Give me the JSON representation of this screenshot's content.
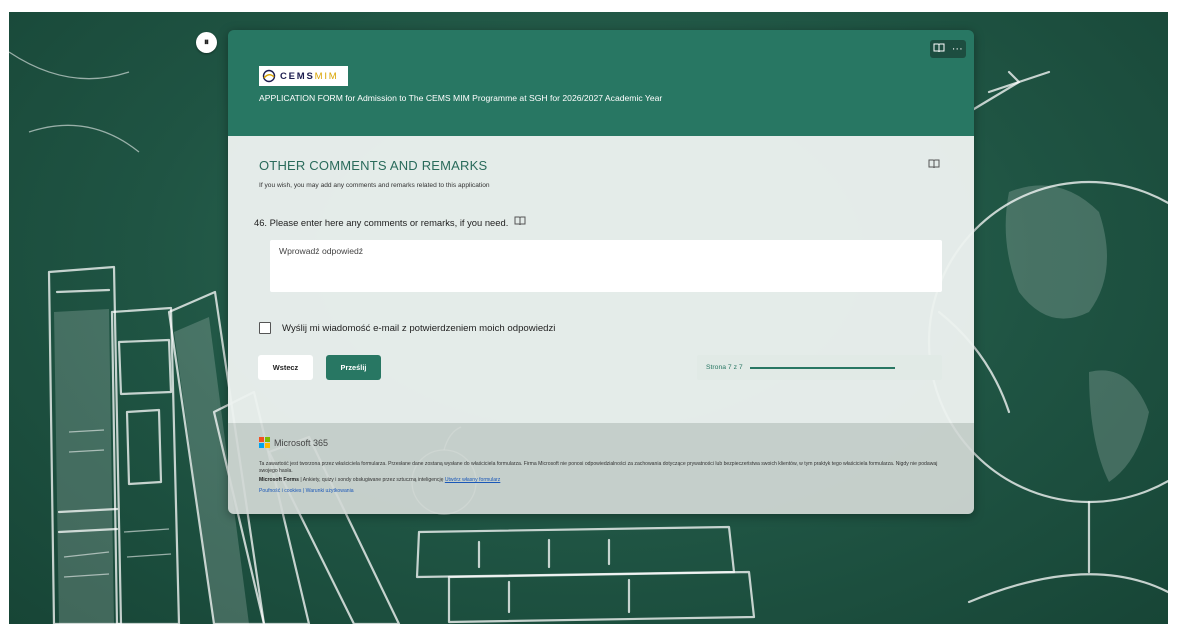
{
  "header": {
    "logo_text_main": "CEMS",
    "logo_text_accent": "MIM",
    "title": "APPLICATION FORM for Admission to The CEMS MIM Programme at SGH for 2026/2027 Academic Year"
  },
  "section": {
    "title": "OTHER COMMENTS AND REMARKS",
    "description": "If you wish, you may add any comments and remarks related to this application"
  },
  "question": {
    "text": "46. Please enter here any comments or remarks, if you need.",
    "placeholder": "Wprowadź odpowiedź"
  },
  "email_copy": {
    "label": "Wyślij mi wiadomość e-mail z potwierdzeniem moich odpowiedzi",
    "checked": false
  },
  "buttons": {
    "back": "Wstecz",
    "submit": "Prześlij"
  },
  "progress": {
    "label": "Strona 7 z 7",
    "fraction": 1.0
  },
  "footer": {
    "brand": "Microsoft 365",
    "disclaimer": "Ta zawartość jest tworzona przez właściciela formularza. Przesłane dane zostaną wysłane do właściciela formularza. Firma Microsoft nie ponosi odpowiedzialności za zachowania dotyczące prywatności lub bezpieczeństwa swoich klientów, w tym praktyk tego właściciela formularza. Nigdy nie podawaj swojego hasła.",
    "forms_name": "Microsoft Forms",
    "forms_tagline": " | Ankiety, quizy i sondy obsługiwane przez sztuczną inteligencję ",
    "create_link": "Utwórz własny formularz",
    "privacy_link": "Poufność i cookies",
    "separator": " | ",
    "terms_link": "Warunki użytkowania"
  },
  "colors": {
    "primary": "#287763",
    "chalkboard": "#1f5443",
    "link": "#1a57b8"
  },
  "icons": {
    "accessibility": "pause-icon",
    "reader": "immersive-reader-icon",
    "more": "more-options-icon"
  }
}
